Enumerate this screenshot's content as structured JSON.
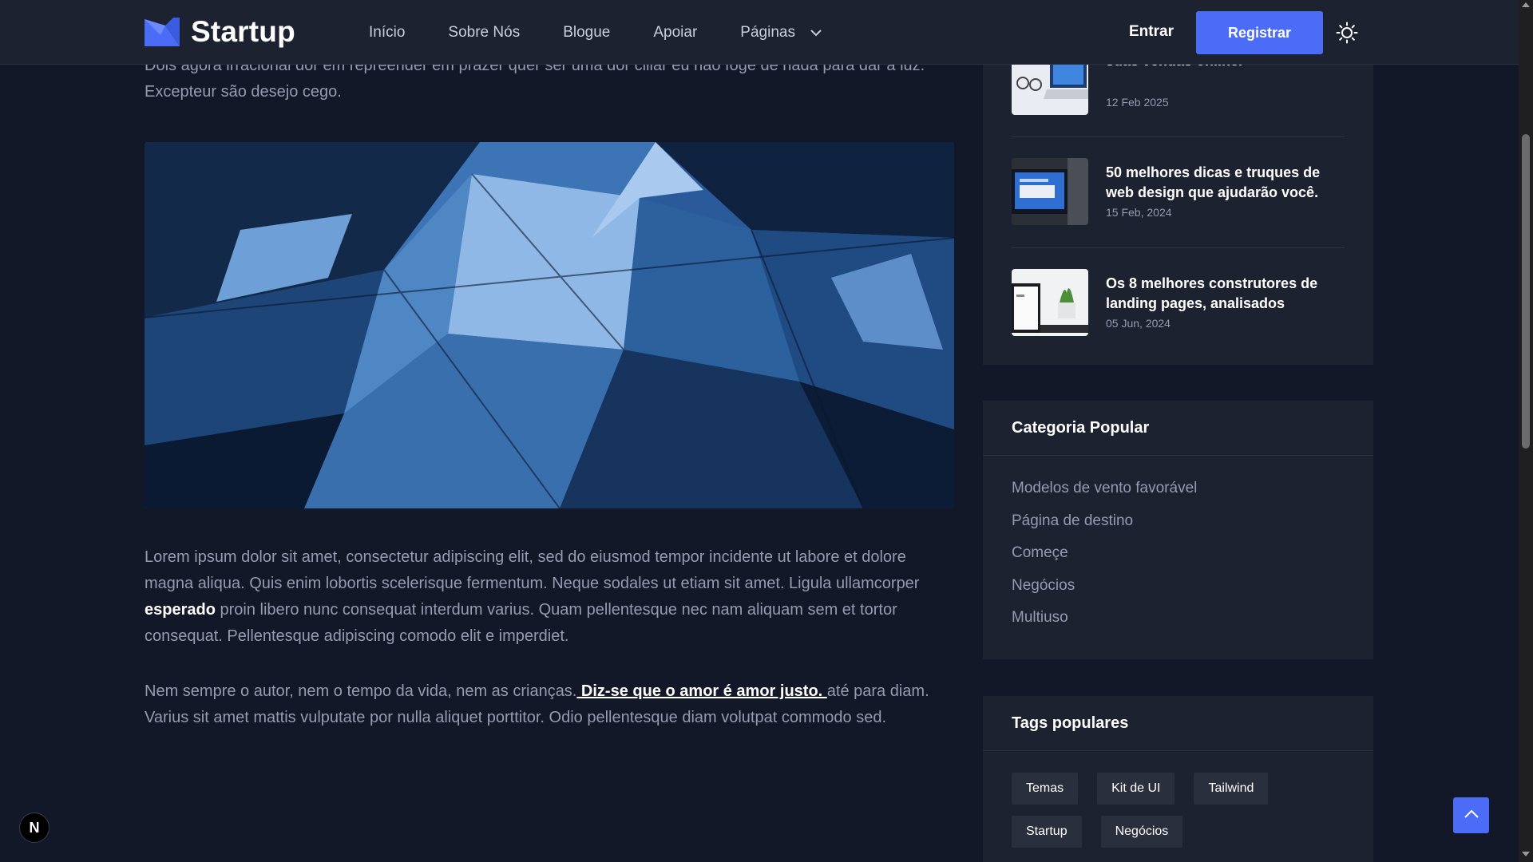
{
  "header": {
    "brand": "Startup",
    "nav": [
      "Início",
      "Sobre Nós",
      "Blogue",
      "Apoiar",
      "Páginas"
    ],
    "signin_label": "Entrar",
    "register_label": "Registrar",
    "accent_color": "#4a6cf7"
  },
  "article": {
    "top_paragraph": "Dois agora irracional dor em repreender em prazer quer ser uma dor ciliar eu não foge de nada para dar à luz. Excepteur são desejo cego.",
    "p1_before": "Lorem ipsum dolor sit amet, consectetur adipiscing elit, sed do eiusmod tempor incidente ut labore et dolore magna aliqua. Quis enim lobortis scelerisque fermentum. Neque sodales ut etiam sit amet. Ligula ullamcorper ",
    "p1_bold": "esperado",
    "p1_after": " proin libero nunc consequat interdum varius. Quam pellentesque nec nam aliquam sem et tortor consequat. Pellentesque adipiscing comodo elit e imperdiet.",
    "p2_before": "Nem sempre o autor, nem o tempo da vida, nem as crianças.",
    "p2_link": " Diz-se que o amor é amor justo. ",
    "p2_after": "até para diam. Varius sit amet mattis vulputate por nulla aliquet porttitor. Odio pellentesque diam volutpat commodo sed."
  },
  "related_posts": [
    {
      "title": "suas vendas online.",
      "date": "12 Feb 2025"
    },
    {
      "title": "50 melhores dicas e truques de web design que ajudarão você.",
      "date": "15 Feb, 2024"
    },
    {
      "title": "Os 8 melhores construtores de landing pages, analisados",
      "date": "05 Jun, 2024"
    }
  ],
  "categories": {
    "heading": "Categoria Popular",
    "items": [
      "Modelos de vento favorável",
      "Página de destino",
      "Começe",
      "Negócios",
      "Multiuso"
    ]
  },
  "tags": {
    "heading": "Tags populares",
    "items": [
      "Temas",
      "Kit de UI",
      "Tailwind",
      "Startup",
      "Negócios"
    ]
  },
  "floating": {
    "badge_letter": "N"
  }
}
